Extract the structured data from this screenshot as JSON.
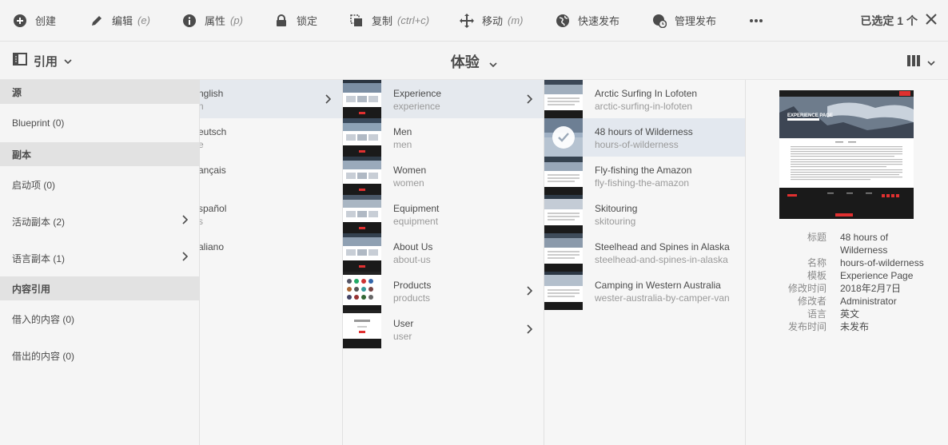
{
  "toolbar": {
    "create": "创建",
    "edit": "编辑",
    "edit_shortcut": "(e)",
    "properties": "属性",
    "properties_shortcut": "(p)",
    "lock": "锁定",
    "copy": "复制",
    "copy_shortcut": "(ctrl+c)",
    "move": "移动",
    "move_shortcut": "(m)",
    "quick_publish": "快速发布",
    "manage_publication": "管理发布",
    "selected_count": "已选定 1 个"
  },
  "header": {
    "rail_label": "引用",
    "title": "体验"
  },
  "rail": {
    "sources_heading": "源",
    "blueprint": "Blueprint (0)",
    "copies_heading": "副本",
    "launches": "启动项 (0)",
    "live_copies": "活动副本 (2)",
    "language_copies": "语言副本 (1)",
    "content_refs_heading": "内容引用",
    "borrowed": "借入的内容 (0)",
    "lent": "借出的内容 (0)"
  },
  "columns": {
    "languages": [
      {
        "title": "nglish",
        "name": "n"
      },
      {
        "title": "eutsch",
        "name": "e"
      },
      {
        "title": "ançais",
        "name": ""
      },
      {
        "title": "spañol",
        "name": "s"
      },
      {
        "title": "aliano",
        "name": ""
      }
    ],
    "sites": [
      {
        "title": "Experience",
        "name": "experience"
      },
      {
        "title": "Men",
        "name": "men"
      },
      {
        "title": "Women",
        "name": "women"
      },
      {
        "title": "Equipment",
        "name": "equipment"
      },
      {
        "title": "About Us",
        "name": "about-us"
      },
      {
        "title": "Products",
        "name": "products"
      },
      {
        "title": "User",
        "name": "user"
      }
    ],
    "pages": [
      {
        "title": "Arctic Surfing In Lofoten",
        "name": "arctic-surfing-in-lofoten"
      },
      {
        "title": "48 hours of Wilderness",
        "name": "hours-of-wilderness"
      },
      {
        "title": "Fly-fishing the Amazon",
        "name": "fly-fishing-the-amazon"
      },
      {
        "title": "Skitouring",
        "name": "skitouring"
      },
      {
        "title": "Steelhead and Spines in Alaska",
        "name": "steelhead-and-spines-in-alaska"
      },
      {
        "title": "Camping in Western Australia",
        "name": "wester-australia-by-camper-van"
      }
    ]
  },
  "detail": {
    "preview_heading": "EXPERIENCE PAGE",
    "title_label": "标题",
    "title_line1": "48 hours of",
    "title_line2": "Wilderness",
    "name_label": "名称",
    "name_value": "hours-of-wilderness",
    "template_label": "模板",
    "template_value": "Experience Page",
    "modified_label": "修改时间",
    "modified_value": "2018年2月7日",
    "modifier_label": "修改者",
    "modifier_value": "Administrator",
    "language_label": "语言",
    "language_value": "英文",
    "published_label": "发布时间",
    "published_value": "未发布"
  },
  "colors": {
    "active_row": "#e5e9ee",
    "rail_section": "#e2e2e2",
    "text": "#4b4b4b",
    "muted": "#9a9a9a"
  }
}
